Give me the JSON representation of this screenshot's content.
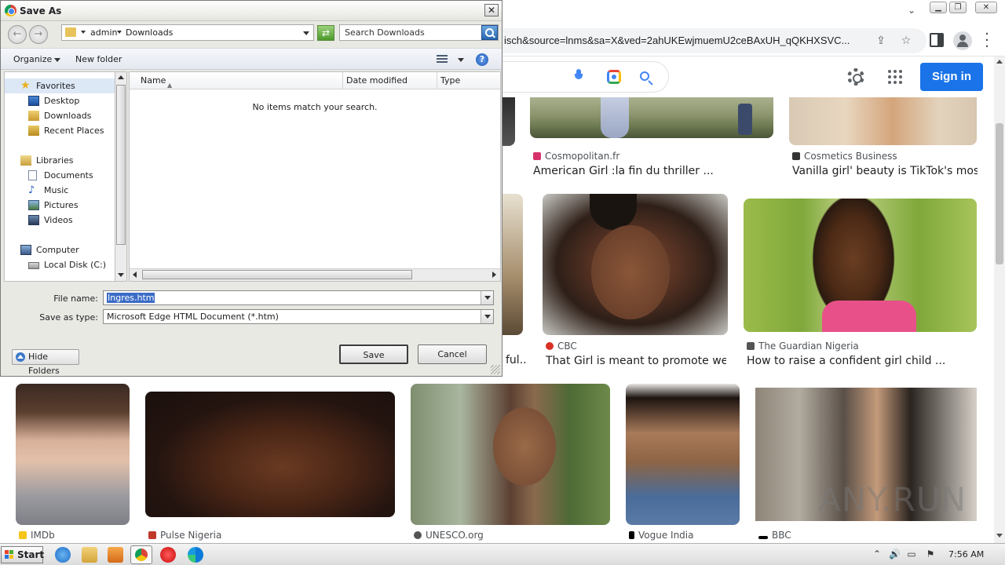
{
  "browser": {
    "url": "isch&source=lnms&sa=X&ved=2ahUKEwjmuemU2ceBAxUH_qQKHXSVC...",
    "signin_label": "Sign in",
    "window_buttons": {
      "minimize": "▁",
      "maximize": "❐",
      "close": "✕"
    }
  },
  "cards": [
    {
      "source": "Cosmopolitan.fr",
      "title": "American Girl :la fin du thriller ...",
      "fav_color": "#d6336c"
    },
    {
      "source": "Cosmetics Business",
      "title": "Vanilla girl' beauty is TikTok's most ...",
      "fav_color": "#333333"
    },
    {
      "source": "CBC",
      "title": "That Girl is meant to promote well...",
      "fav_color": "#d93025"
    },
    {
      "source": "The Guardian Nigeria",
      "title": "How to raise a confident girl child ...",
      "fav_color": "#555555"
    },
    {
      "partial_title": "ful..."
    },
    {
      "source": "IMDb",
      "fav_color": "#f5c518"
    },
    {
      "source": "Pulse Nigeria",
      "fav_color": "#c0392b"
    },
    {
      "source": "UNESCO.org",
      "fav_color": "#555555"
    },
    {
      "source": "Vogue India",
      "fav_color": "#000000"
    },
    {
      "source": "BBC",
      "fav_color": "#000000"
    }
  ],
  "watermark": "ANY.RUN",
  "dialog": {
    "title": "Save As",
    "close_label": "✕",
    "breadcrumb": [
      "admin",
      "Downloads"
    ],
    "search_placeholder": "Search Downloads",
    "organize_label": "Organize",
    "new_folder_label": "New folder",
    "help_label": "?",
    "nav_items": [
      {
        "label": "Favorites",
        "icon": "star-icon",
        "group": true
      },
      {
        "label": "Desktop",
        "icon": "desktop-icon"
      },
      {
        "label": "Downloads",
        "icon": "downloads-folder-icon"
      },
      {
        "label": "Recent Places",
        "icon": "recent-places-icon"
      },
      {
        "label": "Libraries",
        "icon": "libraries-icon",
        "group": true
      },
      {
        "label": "Documents",
        "icon": "documents-icon"
      },
      {
        "label": "Music",
        "icon": "music-icon"
      },
      {
        "label": "Pictures",
        "icon": "pictures-icon"
      },
      {
        "label": "Videos",
        "icon": "videos-icon"
      },
      {
        "label": "Computer",
        "icon": "computer-icon",
        "group": true
      },
      {
        "label": "Local Disk (C:)",
        "icon": "disk-icon"
      }
    ],
    "columns": [
      "Name",
      "Date modified",
      "Type"
    ],
    "empty_message": "No items match your search.",
    "file_name_label": "File name:",
    "file_name_value": "Ingres.htm",
    "save_type_label": "Save as type:",
    "save_type_value": "Microsoft Edge HTML Document (*.htm)",
    "hide_folders_label": "Hide Folders",
    "save_label": "Save",
    "cancel_label": "Cancel"
  },
  "taskbar": {
    "start_label": "Start",
    "clock": "7:56 AM"
  }
}
